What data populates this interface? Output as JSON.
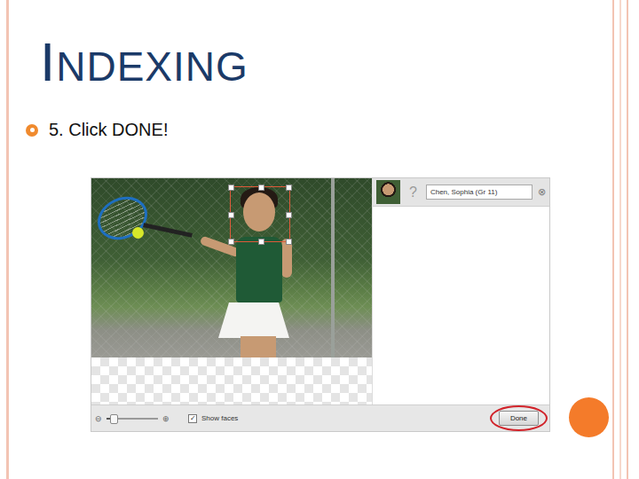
{
  "slide": {
    "title": "INDEXING",
    "bullet": "5. Click DONE!"
  },
  "app": {
    "tag": {
      "prompt": "?",
      "name": "Chen, Sophia (Gr 11)",
      "remove": "⊗"
    },
    "zoom": {
      "minus": "⊖",
      "plus": "⊕",
      "level": 0.15
    },
    "show_faces": {
      "label": "Show faces",
      "checked": true,
      "check": "✓"
    },
    "done_button": {
      "label": "Done",
      "highlighted": true
    }
  }
}
